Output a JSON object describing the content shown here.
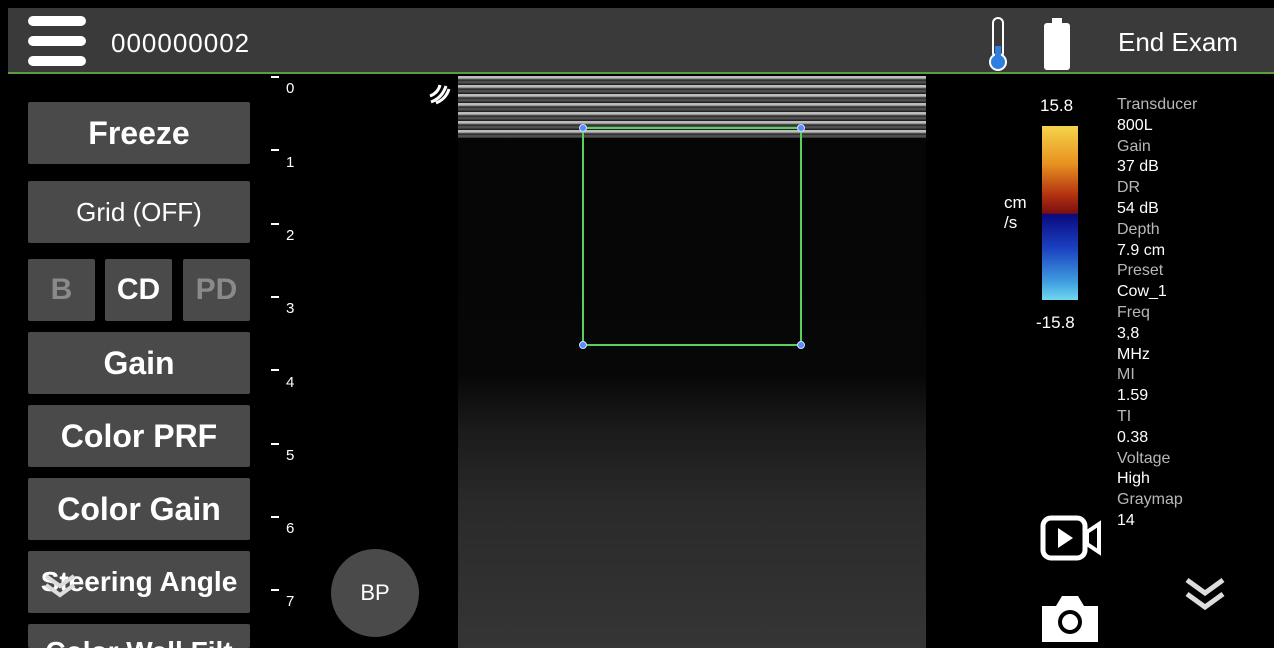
{
  "topbar": {
    "patient_id": "000000002",
    "end_exam_label": "End Exam"
  },
  "left_panel": {
    "freeze_label": "Freeze",
    "grid_label": "Grid (OFF)",
    "mode_b_label": "B",
    "mode_cd_label": "CD",
    "mode_pd_label": "PD",
    "gain_label": "Gain",
    "color_prf_label": "Color PRF",
    "color_gain_label": "Color Gain",
    "steering_angle_label": "Steering Angle",
    "color_wall_filter_label": "Color Wall Filt"
  },
  "depth_ruler": {
    "labels": [
      "0",
      "1",
      "2",
      "3",
      "4",
      "5",
      "6",
      "7"
    ]
  },
  "bp_label": "BP",
  "color_scale": {
    "top_value": "15.8",
    "bottom_value": "-15.8",
    "unit_line1": "cm",
    "unit_line2": "/s"
  },
  "parameters": [
    {
      "key": "Transducer",
      "value": "800L"
    },
    {
      "key": "Gain",
      "value": "37 dB"
    },
    {
      "key": "DR",
      "value": "54 dB"
    },
    {
      "key": "Depth",
      "value": "7.9 cm"
    },
    {
      "key": "Preset",
      "value": "Cow_1"
    },
    {
      "key": "Freq",
      "value": "3,8"
    },
    {
      "key": "",
      "value": "MHz"
    },
    {
      "key": "MI",
      "value": "1.59"
    },
    {
      "key": "TI",
      "value": "0.38"
    },
    {
      "key": "Voltage",
      "value": "High"
    },
    {
      "key": "Graymap",
      "value": "14"
    }
  ],
  "icons": {
    "menu": "hamburger-menu-icon",
    "thermometer": "thermometer-icon",
    "battery": "battery-icon",
    "probe": "probe-orientation-icon",
    "video": "video-record-icon",
    "camera": "camera-icon",
    "chevron_down": "chevron-down-icon"
  },
  "colors": {
    "accent_green": "#5aa03a",
    "roi_green": "#5ad25a",
    "button_gray": "#4a4a4a",
    "topbar": "#3a3a3a"
  }
}
